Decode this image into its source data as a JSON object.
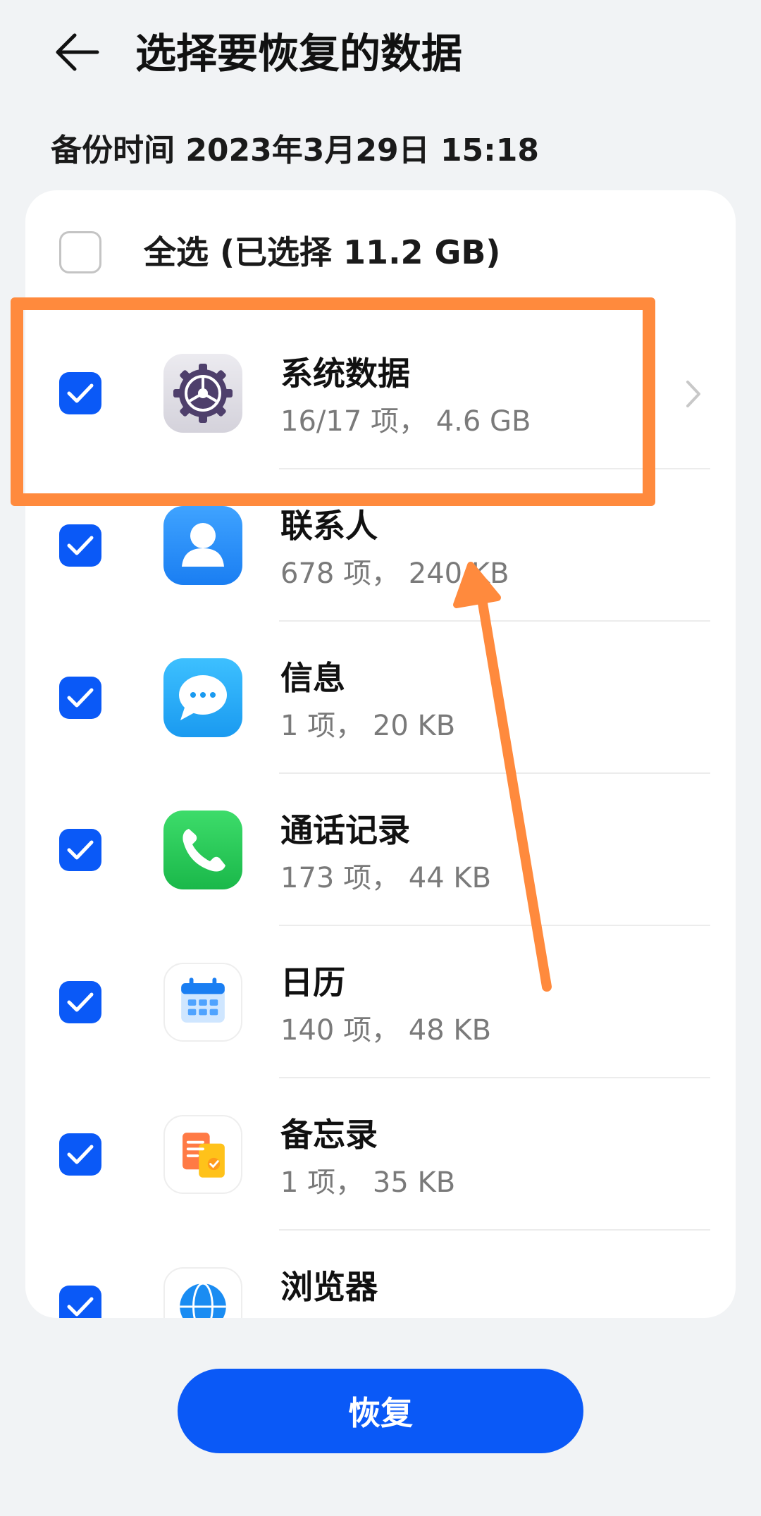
{
  "header": {
    "title": "选择要恢复的数据",
    "back_icon": "arrow-left-icon"
  },
  "backup_time": "备份时间 2023年3月29日 15:18",
  "select_all": {
    "label": "全选 (已选择 11.2 GB)",
    "checked": false
  },
  "items": [
    {
      "title": "系统数据",
      "subtitle": "16/17 项， 4.6 GB",
      "icon": "settings-gear-icon",
      "checked": true,
      "has_chevron": true
    },
    {
      "title": "联系人",
      "subtitle": "678 项， 240 KB",
      "icon": "contacts-icon",
      "checked": true
    },
    {
      "title": "信息",
      "subtitle": "1 项， 20 KB",
      "icon": "messages-icon",
      "checked": true
    },
    {
      "title": "通话记录",
      "subtitle": "173 项， 44 KB",
      "icon": "phone-icon",
      "checked": true
    },
    {
      "title": "日历",
      "subtitle": "140 项， 48 KB",
      "icon": "calendar-icon",
      "checked": true
    },
    {
      "title": "备忘录",
      "subtitle": "1 项， 35 KB",
      "icon": "notepad-icon",
      "checked": true
    },
    {
      "title": "浏览器",
      "subtitle": "",
      "icon": "browser-icon",
      "checked": true
    }
  ],
  "restore_button": "恢复",
  "colors": {
    "accent": "#0a59f7",
    "annotation": "#ff8a3d",
    "background": "#f1f3f5"
  }
}
